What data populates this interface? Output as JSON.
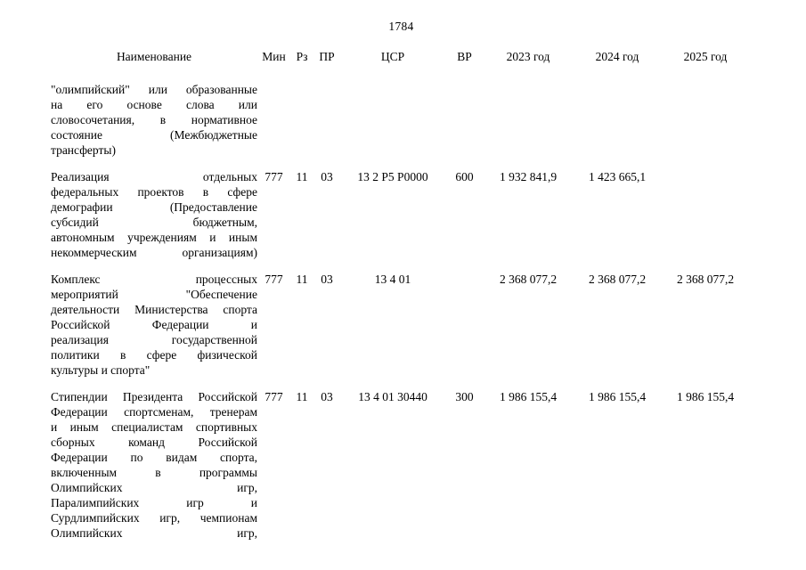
{
  "page": {
    "number": "1784"
  },
  "table": {
    "headers": {
      "name": "Наименование",
      "min": "Мин",
      "rz": "Рз",
      "pr": "ПР",
      "csr": "ЦСР",
      "vr": "ВР",
      "year1": "2023 год",
      "year2": "2024 год",
      "year3": "2025 год"
    },
    "rows": [
      {
        "name_lines": [
          "\"олимпийский\" или образованные",
          "на его основе слова или",
          "словосочетания, в нормативное",
          "состояние (Межбюджетные",
          "трансферты)"
        ],
        "name_last_line_justified": false,
        "min": "",
        "rz": "",
        "pr": "",
        "csr": "",
        "vr": "",
        "year1": "",
        "year2": "",
        "year3": ""
      },
      {
        "name_lines": [
          "Реализация отдельных",
          "федеральных проектов в сфере",
          "демографии (Предоставление",
          "субсидий бюджетным,",
          "автономным учреждениям и иным",
          "некоммерческим организациям)"
        ],
        "name_last_line_justified": true,
        "min": "777",
        "rz": "11",
        "pr": "03",
        "csr": "13 2 Р5 Р0000",
        "vr": "600",
        "year1": "1 932 841,9",
        "year2": "1 423 665,1",
        "year3": ""
      },
      {
        "name_lines": [
          "Комплекс процессных",
          "мероприятий \"Обеспечение",
          "деятельности Министерства спорта",
          "Российской Федерации и",
          "реализация государственной",
          "политики в сфере физической",
          "культуры и спорта\""
        ],
        "name_last_line_justified": false,
        "min": "777",
        "rz": "11",
        "pr": "03",
        "csr": "13 4 01",
        "vr": "",
        "year1": "2 368 077,2",
        "year2": "2 368 077,2",
        "year3": "2 368 077,2"
      },
      {
        "name_lines": [
          "Стипендии Президента Российской",
          "Федерации спортсменам, тренерам",
          "и иным специалистам спортивных",
          "сборных команд Российской",
          "Федерации по видам спорта,",
          "включенным в программы",
          "Олимпийских игр,",
          "Паралимпийских игр и",
          "Сурдлимпийских игр, чемпионам",
          "Олимпийских игр,"
        ],
        "name_last_line_justified": true,
        "min": "777",
        "rz": "11",
        "pr": "03",
        "csr": "13 4 01 30440",
        "vr": "300",
        "year1": "1 986 155,4",
        "year2": "1 986 155,4",
        "year3": "1 986 155,4"
      }
    ]
  }
}
